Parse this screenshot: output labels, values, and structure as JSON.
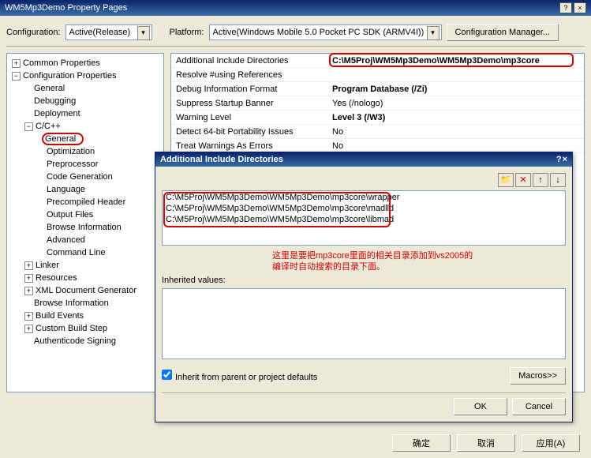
{
  "window": {
    "title": "WM5Mp3Demo Property Pages"
  },
  "top": {
    "config_label": "Configuration:",
    "config_value": "Active(Release)",
    "platform_label": "Platform:",
    "platform_value": "Active(Windows Mobile 5.0 Pocket PC SDK (ARMV4I))",
    "mgr_btn": "Configuration Manager..."
  },
  "tree": {
    "common": "Common Properties",
    "config": "Configuration Properties",
    "items1": [
      "General",
      "Debugging",
      "Deployment"
    ],
    "ccpp": "C/C++",
    "cc_items": [
      "General",
      "Optimization",
      "Preprocessor",
      "Code Generation",
      "Language",
      "Precompiled Header",
      "Output Files",
      "Browse Information",
      "Advanced",
      "Command Line"
    ],
    "items2": [
      "Linker",
      "Resources",
      "XML Document Generator",
      "Browse Information",
      "Build Events",
      "Custom Build Step",
      "Authenticode Signing"
    ]
  },
  "grid": {
    "rows": [
      {
        "l": "Additional Include Directories",
        "v": "C:\\M5Proj\\WM5Mp3Demo\\WM5Mp3Demo\\mp3core",
        "b": true
      },
      {
        "l": "Resolve #using References",
        "v": "",
        "b": false
      },
      {
        "l": "Debug Information Format",
        "v": "Program Database (/Zi)",
        "b": true
      },
      {
        "l": "Suppress Startup Banner",
        "v": "Yes (/nologo)",
        "b": false
      },
      {
        "l": "Warning Level",
        "v": "Level 3 (/W3)",
        "b": true
      },
      {
        "l": "Detect 64-bit Portability Issues",
        "v": "No",
        "b": false
      },
      {
        "l": "Treat Warnings As Errors",
        "v": "No",
        "b": false
      }
    ]
  },
  "dialog": {
    "title": "Additional Include Directories",
    "icons": {
      "folder": "📁",
      "del": "✕",
      "up": "↑",
      "dn": "↓"
    },
    "paths": [
      "C:\\M5Proj\\WM5Mp3Demo\\WM5Mp3Demo\\mp3core\\wrapper",
      "C:\\M5Proj\\WM5Mp3Demo\\WM5Mp3Demo\\mp3core\\madlld",
      "C:\\M5Proj\\WM5Mp3Demo\\WM5Mp3Demo\\mp3core\\libmad"
    ],
    "note1": "这里是要把mp3core里面的相关目录添加到vs2005的",
    "note2": "编译时自动搜索的目录下面。",
    "inherited": "Inherited values:",
    "inherit_chk": "Inherit from parent or project defaults",
    "macros": "Macros>>",
    "ok": "OK",
    "cancel": "Cancel"
  },
  "footer": {
    "ok": "确定",
    "cancel": "取消",
    "apply": "应用(A)"
  }
}
